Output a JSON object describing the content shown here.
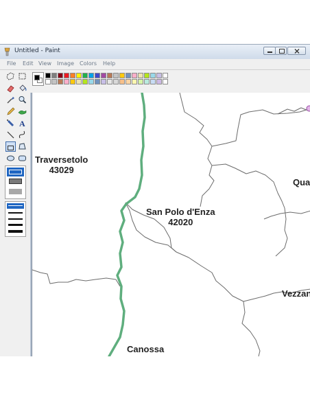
{
  "window": {
    "title": "Untitled - Paint"
  },
  "menu": [
    "File",
    "Edit",
    "View",
    "Image",
    "Colors",
    "Help"
  ],
  "palette": {
    "foreground": "#000000",
    "background": "#ffffff",
    "row1": [
      "#000000",
      "#7f7f7f",
      "#880015",
      "#ed1c24",
      "#ff7f27",
      "#fff200",
      "#22b14c",
      "#00a2e8",
      "#3f48cc",
      "#a349a4",
      "#b97a57",
      "#c3c3c3",
      "#ffc90e",
      "#7092be",
      "#ffaec9",
      "#efe4b0",
      "#b5e61d",
      "#99d9ea",
      "#c8bfe7",
      "#ffffff"
    ],
    "row2": [
      "#ffffff",
      "#c3c3c3",
      "#b97a57",
      "#ffaec9",
      "#ffc90e",
      "#efe4b0",
      "#b5e61d",
      "#99d9ea",
      "#7092be",
      "#c8bfe7",
      "#e6e6e6",
      "#d9d9d9",
      "#f7c08a",
      "#fdd5a5",
      "#fff7b0",
      "#d7f5a8",
      "#b9ebde",
      "#c8dcf5",
      "#cdb9e6",
      "#ffffff"
    ]
  },
  "tools": [
    "free-form-select",
    "select",
    "eraser",
    "fill",
    "color-picker",
    "magnifier",
    "pencil",
    "brush",
    "airbrush",
    "text",
    "line",
    "curve",
    "rectangle",
    "polygon",
    "ellipse",
    "rounded-rectangle"
  ],
  "map": {
    "boundary_color": "#6b6b6b",
    "river_color": "#5fae7e",
    "labels": [
      {
        "name": "Traversetolo",
        "code": "43029"
      },
      {
        "name": "San Polo d'Enza",
        "code": "42020"
      },
      {
        "name": "Quat"
      },
      {
        "name": "Vezzan"
      },
      {
        "name": "Canossa"
      }
    ]
  }
}
